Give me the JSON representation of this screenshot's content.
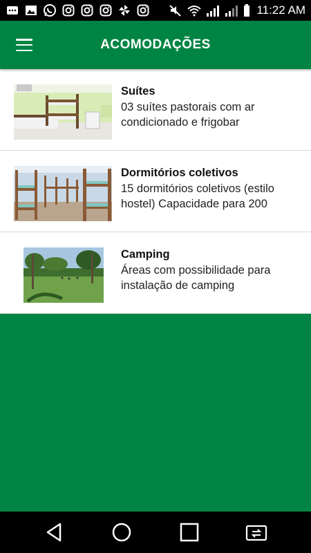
{
  "status_bar": {
    "time": "11:22 AM",
    "left_icons": [
      "message-icon",
      "image-icon",
      "whatsapp-icon",
      "instagram-icon",
      "instagram-icon",
      "instagram-icon",
      "pinwheel-icon",
      "instagram-icon"
    ],
    "right_icons": [
      "mute-icon",
      "wifi-icon",
      "signal-4g-icon",
      "signal-2g-icon",
      "battery-icon"
    ]
  },
  "app_bar": {
    "title": "ACOMODAÇÕES",
    "color": "#008443"
  },
  "items": [
    {
      "title": "Suítes",
      "description": "03 suítes pastorais com ar condicionado e frigobar",
      "image": "room-with-bunk-beds"
    },
    {
      "title": "Dormitórios coletivos",
      "description": "15 dormitórios coletivos (estilo hostel) Capacidade para 200",
      "image": "dormitory-bunk-beds"
    },
    {
      "title": "Camping",
      "description": "Áreas com possibilidade para instalação de camping",
      "image": "grass-field-with-palm-trees"
    }
  ],
  "nav_bar": {
    "buttons": [
      "back-icon",
      "home-icon",
      "recents-icon",
      "screen-mirror-icon"
    ]
  }
}
